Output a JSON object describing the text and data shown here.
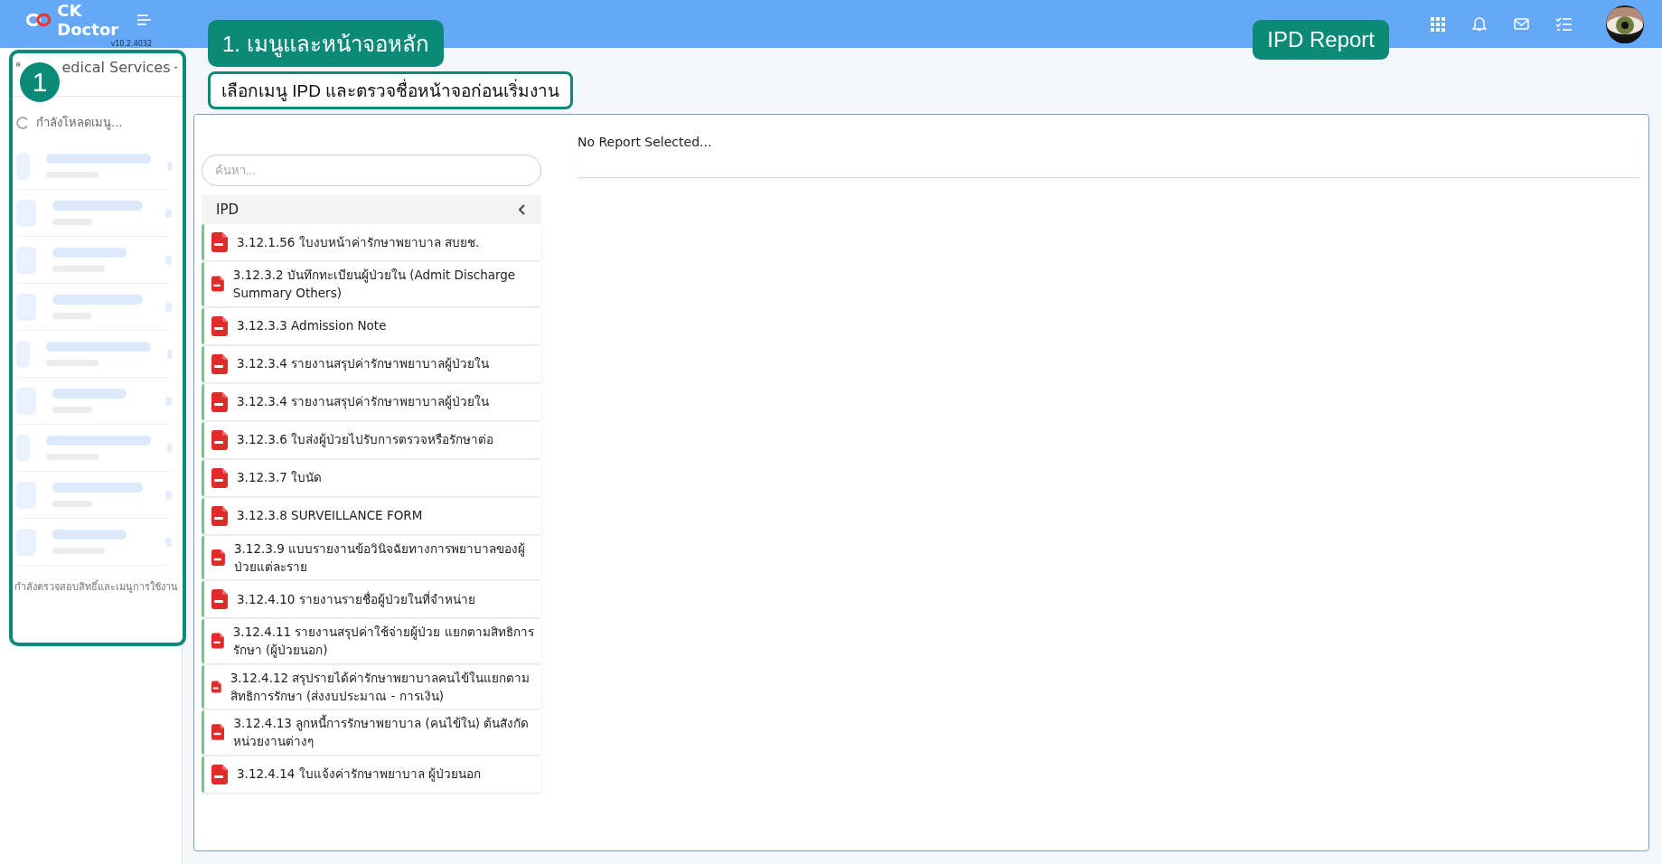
{
  "header": {
    "logo": "CK Doctor",
    "version": "v10.2.4032"
  },
  "annotations": {
    "badge": "1",
    "title": "1. เมนูและหน้าจอหลัก",
    "instruction": "เลือกเมนู IPD และตรวจชื่อหน้าจอก่อนเริ่มงาน",
    "page_label": "IPD Report"
  },
  "sidebar": {
    "title": "edical Services",
    "loading": "กำลังโหลดเมนู...",
    "status": "กำลังตรวจสอบสิทธิ์และเมนูการใช้งาน"
  },
  "reports": {
    "search": {
      "placeholder": "ค้นหา..."
    },
    "group": {
      "label": "IPD",
      "expanded": true
    },
    "items": [
      {
        "label": "3.12.1.56 ใบงบหน้าค่ารักษาพยาบาล สบยช."
      },
      {
        "label": "3.12.3.2 บันทึกทะเบียนผู้ป่วยใน (Admit Discharge Summary Others)"
      },
      {
        "label": "3.12.3.3 Admission Note"
      },
      {
        "label": "3.12.3.4 รายงานสรุปค่ารักษาพยาบาลผู้ป่วยใน"
      },
      {
        "label": "3.12.3.4 รายงานสรุปค่ารักษาพยาบาลผู้ป่วยใน"
      },
      {
        "label": "3.12.3.6 ใบส่งผู้ป่วยไปรับการตรวจหรือรักษาต่อ"
      },
      {
        "label": "3.12.3.7 ใบนัด"
      },
      {
        "label": "3.12.3.8 SURVEILLANCE FORM"
      },
      {
        "label": "3.12.3.9 แบบรายงานข้อวินิจฉัยทางการพยาบาลของผู้ป่วยแต่ละราย"
      },
      {
        "label": "3.12.4.10 รายงานรายชื่อผู้ป่วยในที่จำหน่าย"
      },
      {
        "label": "3.12.4.11 รายงานสรุปค่าใช้จ่ายผู้ป่วย แยกตามสิทธิการรักษา (ผู้ป่วยนอก)"
      },
      {
        "label": "3.12.4.12 สรุปรายได้ค่ารักษาพยาบาลคนไข้ในแยกตามสิทธิการรักษา (ส่งงบประมาณ - การเงิน)"
      },
      {
        "label": "3.12.4.13 ลูกหนี้การรักษาพยาบาล (คนไข้ใน) ต้นสังกัดหน่วยงานต่างๆ"
      },
      {
        "label": "3.12.4.14 ใบแจ้งค่ารักษาพยาบาล ผู้ป่วยนอก"
      }
    ]
  },
  "viewer": {
    "message": "No Report Selected..."
  }
}
